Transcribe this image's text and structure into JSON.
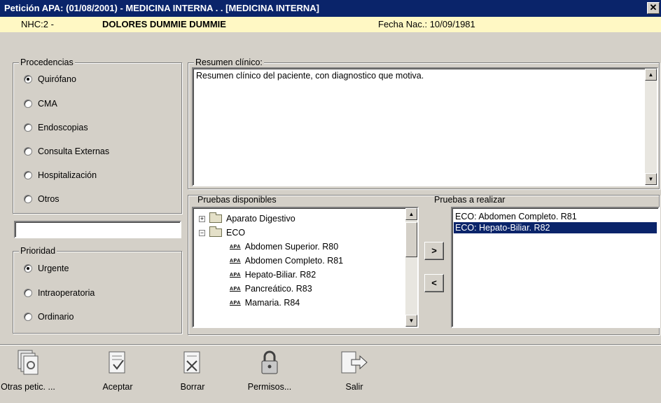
{
  "window": {
    "title": "Petición APA: (01/08/2001) - MEDICINA INTERNA . . [MEDICINA INTERNA]",
    "close": "✕"
  },
  "patient": {
    "nhc": "NHC:2 -",
    "name": "DOLORES DUMMIE DUMMIE",
    "birth": "Fecha Nac.: 10/09/1981"
  },
  "procedencias": {
    "label": "Procedencias",
    "options": [
      "Quirófano",
      "CMA",
      "Endoscopias",
      "Consulta Externas",
      "Hospitalización",
      "Otros"
    ],
    "selected": "Quirófano"
  },
  "otros_input": {
    "value": ""
  },
  "prioridad": {
    "label": "Prioridad",
    "options": [
      "Urgente",
      "Intraoperatoria",
      "Ordinario"
    ],
    "selected": "Urgente"
  },
  "resumen": {
    "label": "Resumen clínico:",
    "text": "Resumen clínico del paciente, con diagnostico que motiva."
  },
  "disponibles": {
    "label": "Pruebas disponibles",
    "tree": [
      {
        "type": "folder",
        "expander": "+",
        "label": "Aparato Digestivo"
      },
      {
        "type": "folder",
        "expander": "−",
        "label": "ECO"
      },
      {
        "type": "leaf",
        "icon": "APA",
        "label": "Abdomen Superior. R80"
      },
      {
        "type": "leaf",
        "icon": "APA",
        "label": "Abdomen Completo. R81"
      },
      {
        "type": "leaf",
        "icon": "APA",
        "label": "Hepato-Biliar. R82"
      },
      {
        "type": "leaf",
        "icon": "APA",
        "label": "Pancreático. R83"
      },
      {
        "type": "leaf",
        "icon": "APA",
        "label": "Mamaria. R84"
      }
    ]
  },
  "transfer": {
    "add": ">",
    "remove": "<"
  },
  "realizar": {
    "label": "Pruebas a realizar",
    "items": [
      {
        "label": "ECO: Abdomen Completo. R81",
        "selected": false
      },
      {
        "label": "ECO: Hepato-Biliar. R82",
        "selected": true
      }
    ]
  },
  "toolbar": {
    "otras": "Otras petic. ...",
    "aceptar": "Aceptar",
    "borrar": "Borrar",
    "permisos": "Permisos...",
    "salir": "Salir"
  },
  "colors": {
    "titlebar": "#0a246a",
    "patient_bar": "#fff8c4",
    "face": "#d4d0c8",
    "selection": "#0a246a"
  }
}
